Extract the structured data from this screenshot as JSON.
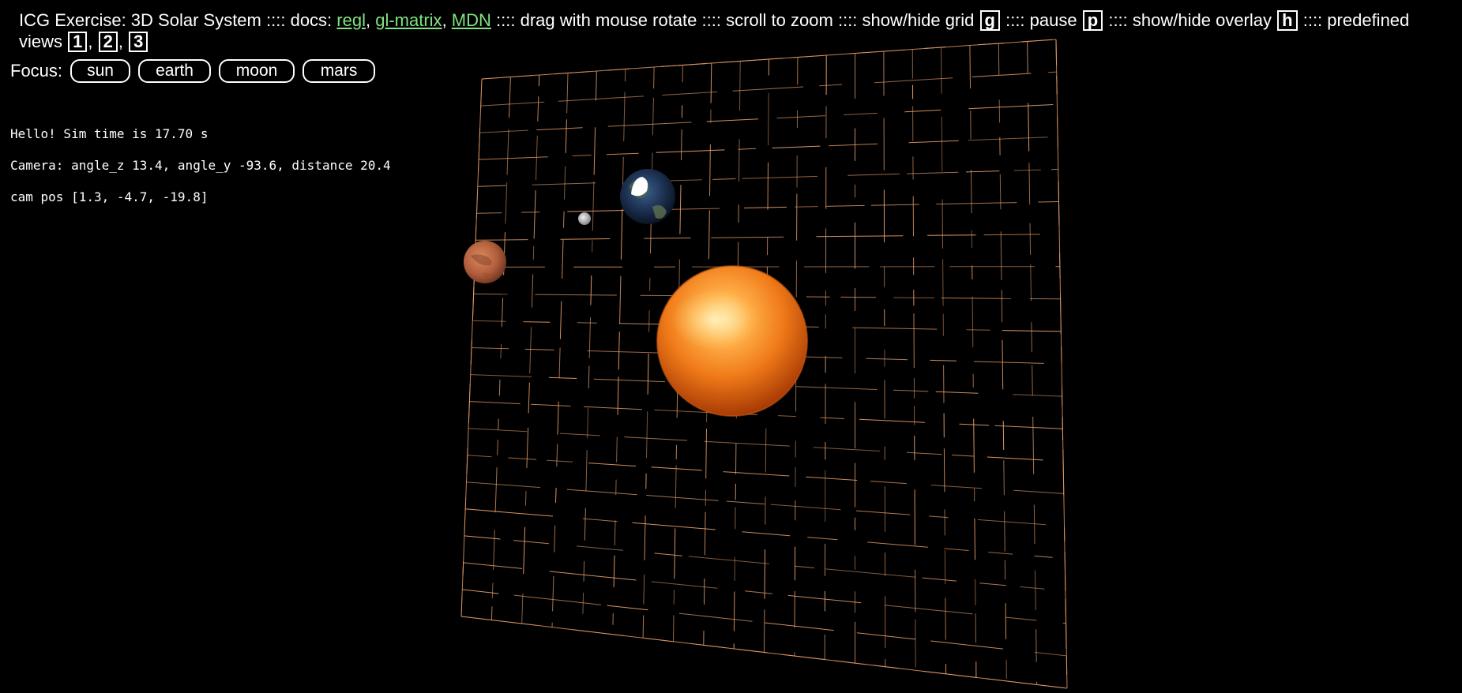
{
  "header": {
    "title": "ICG Exercise: 3D Solar System",
    "sep": "::::",
    "docs_label": "docs:",
    "links": [
      "regl",
      "gl-matrix",
      "MDN"
    ],
    "drag": "drag with mouse rotate",
    "scroll": "scroll to zoom",
    "grid": "show/hide grid",
    "grid_key": "g",
    "pause": "pause",
    "pause_key": "p",
    "overlay": "show/hide overlay",
    "overlay_key": "h",
    "views_pre": "predefined",
    "views": "views",
    "view_keys": [
      "1",
      "2",
      "3"
    ]
  },
  "focus": {
    "label": "Focus:",
    "buttons": [
      "sun",
      "earth",
      "moon",
      "mars"
    ]
  },
  "overlay": {
    "line1": "Hello! Sim time is 17.70 s",
    "line2": "Camera: angle_z 13.4, angle_y -93.6, distance 20.4",
    "line3": "cam pos [1.3, -4.7, -19.8]"
  },
  "colors": {
    "link": "#7fe37f",
    "grid": "#e8a06a",
    "background": "#000000"
  }
}
